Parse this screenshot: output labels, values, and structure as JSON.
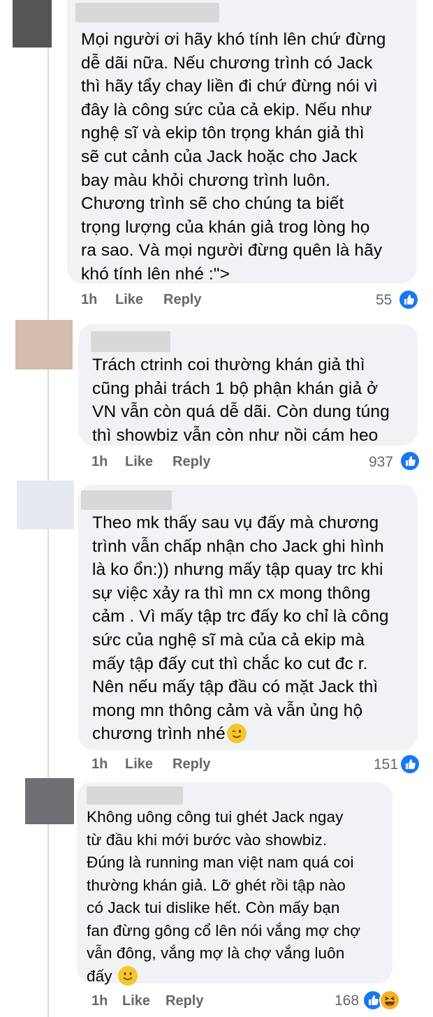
{
  "comments": [
    {
      "text": "Mọi người ơi hãy khó tính lên chứ đừng\ndễ dãi nữa. Nếu chương trình có Jack\nthì hãy tẩy chay liền đi chứ đừng nói vì\nđây là công sức của cả ekip. Nếu như\nnghệ sĩ và ekip tôn trọng khán giả thì\nsẽ cut cảnh của Jack hoặc cho Jack\nbay màu khỏi chương trình luôn.\nChương trình sẽ cho chúng ta biết\ntrọng lượng của khán giả trog lòng họ\nra sao. Và mọi người đừng quên là hãy\nkhó tính lên nhé :\">",
      "time": "1h",
      "like_label": "Like",
      "reply_label": "Reply",
      "reaction_count": "55",
      "reactions": [
        "like-icon"
      ],
      "avatar_color": "#555555"
    },
    {
      "text": "Trách ctrinh coi thường khán giả thì\ncũng phải trách 1 bộ phận khán giả ở\nVN vẫn còn quá dễ dãi. Còn dung túng\nthì showbiz vẫn còn như nồi cám heo",
      "time": "1h",
      "like_label": "Like",
      "reply_label": "Reply",
      "reaction_count": "937",
      "reactions": [
        "like-icon"
      ],
      "avatar_color": "#d4bcab"
    },
    {
      "text": "Theo mk thấy sau vụ đấy mà chương\ntrình vẫn chấp nhận cho Jack ghi hình\nlà ko ổn:)) nhưng mấy tập quay trc khi\nsự việc xảy ra thì mn cx mong thông\ncảm . Vì mấy tập trc đấy ko chỉ là công\nsức của nghệ sĩ mà của cả ekip mà\nmấy tập đấy cut thì chắc ko cut đc r.\nNên nếu mấy tập đầu có mặt Jack thì\nmong mn thông cảm và vẫn ủng hộ\nchương trình nhé",
      "emoji": "winking-face-emoji",
      "time": "1h",
      "like_label": "Like",
      "reply_label": "Reply",
      "reaction_count": "151",
      "reactions": [
        "like-icon"
      ],
      "avatar_color": "#e6e8f2"
    },
    {
      "text": "Không uông công tui ghét Jack ngay\ntừ đầu khi mới bước vào showbiz.\nĐúng là running man việt nam quá coi\nthường khán giả. Lỡ ghét rồi tập nào\ncó Jack tui dislike hết. Còn mấy bạn\nfan đừng gông cổ lên nói vắng mợ chợ\nvẫn đông, vắng mợ là chợ vắng luôn\nđấy",
      "emoji": "smiling-face-emoji",
      "time": "1h",
      "like_label": "Like",
      "reply_label": "Reply",
      "reaction_count": "168",
      "reactions": [
        "like-icon",
        "haha-icon"
      ],
      "avatar_color": "#6f7073"
    }
  ],
  "colors": {
    "bubble": "#f0f2f5",
    "meta_text": "#65676b",
    "like_blue": "#1877f2",
    "haha_yellow": "#f7b125"
  }
}
